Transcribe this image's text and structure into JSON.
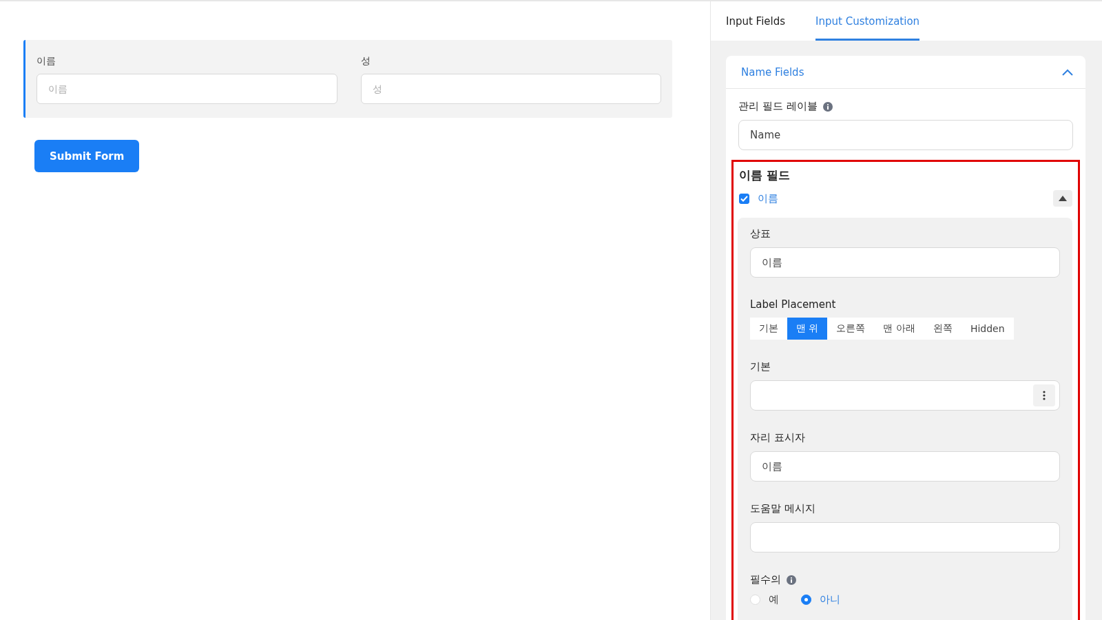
{
  "form": {
    "fields": [
      {
        "label": "이름",
        "placeholder": "이름"
      },
      {
        "label": "성",
        "placeholder": "성"
      }
    ],
    "submit": "Submit Form"
  },
  "tabs": [
    {
      "label": "Input Fields",
      "selected": false
    },
    {
      "label": "Input Customization",
      "selected": true
    }
  ],
  "section": {
    "title": "Name Fields",
    "expanded": true,
    "admin_label": {
      "label": "관리 필드 레이블",
      "value": "Name"
    },
    "subfields": {
      "title": "이름 필드",
      "items": [
        {
          "label": "이름",
          "checked": true,
          "expanded": true,
          "settings": {
            "label_field": {
              "label": "상표",
              "value": "이름"
            },
            "placement": {
              "label": "Label Placement",
              "options": [
                {
                  "label": "기본",
                  "selected": false
                },
                {
                  "label": "맨 위",
                  "selected": true
                },
                {
                  "label": "오른쪽",
                  "selected": false
                },
                {
                  "label": "맨 아래",
                  "selected": false
                },
                {
                  "label": "왼쪽",
                  "selected": false
                },
                {
                  "label": "Hidden",
                  "selected": false
                }
              ]
            },
            "default_field": {
              "label": "기본"
            },
            "placeholder_field": {
              "label": "자리 표시자",
              "value": "이름"
            },
            "help_field": {
              "label": "도움말 메시지"
            },
            "required": {
              "label": "필수의",
              "options": [
                {
                  "label": "예",
                  "selected": false
                },
                {
                  "label": "아니",
                  "selected": true
                }
              ]
            }
          }
        }
      ]
    }
  }
}
